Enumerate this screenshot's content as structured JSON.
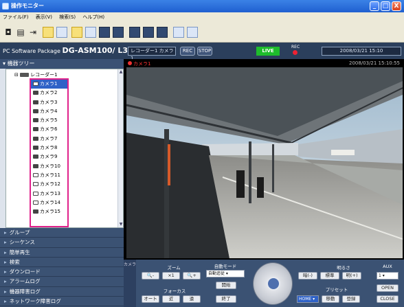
{
  "window": {
    "title": "操作モニター",
    "buttons": [
      "_",
      "□",
      "X"
    ]
  },
  "menu": [
    "ファイル(F)",
    "表示(V)",
    "検索(S)",
    "ヘルプ(H)"
  ],
  "header": {
    "product_prefix": "PC Software Package ",
    "product_name": "DG-ASM100/ L3",
    "source": "レコーダー1 カメラ1",
    "btn_rec": "REC",
    "btn_stop": "STOP",
    "live": "LIVE",
    "rec_label": "REC",
    "datetime": "2008/03/21 15:10"
  },
  "tree": {
    "header": "機器ツリー",
    "recorder": "レコーダー1",
    "cameras": [
      "カメラ1",
      "カメラ2",
      "カメラ3",
      "カメラ4",
      "カメラ5",
      "カメラ6",
      "カメラ7",
      "カメラ8",
      "カメラ9",
      "カメラ10",
      "カメラ11",
      "カメラ12",
      "カメラ13",
      "カメラ14",
      "カメラ15"
    ],
    "scroll_up": "▲",
    "scroll_down": "▼"
  },
  "nav": [
    "グループ",
    "シーケンス",
    "簡単再生",
    "検索",
    "ダウンロード",
    "アラームログ",
    "機器障害ログ",
    "ネットワーク障害ログ"
  ],
  "viewer": {
    "camera": "カメラ1",
    "timestamp": "2008/03/21 15:10:55"
  },
  "controls": {
    "tab": "カメラ",
    "zoom": {
      "label": "ズーム",
      "minus": "-",
      "x1": "×1",
      "plus": "+"
    },
    "focus": {
      "label": "フォーカス",
      "auto": "オート",
      "near": "近",
      "far": "遠"
    },
    "automode": {
      "label": "自動モード",
      "value": "自動追従",
      "start": "開始",
      "end": "終了"
    },
    "brightness": {
      "label": "明るさ",
      "dark": "暗(-)",
      "std": "標準",
      "bright": "明(+)"
    },
    "preset": {
      "label": "プリセット",
      "value": "HOME",
      "move": "移動",
      "register": "登録"
    },
    "aux": {
      "label": "AUX",
      "value": "1",
      "open": "OPEN",
      "close": "CLOSE"
    }
  },
  "colors": {
    "selection": "#2f62c7",
    "highlight_border": "#e0208a",
    "live": "#1ebc2c",
    "panel": "#3b5273"
  }
}
